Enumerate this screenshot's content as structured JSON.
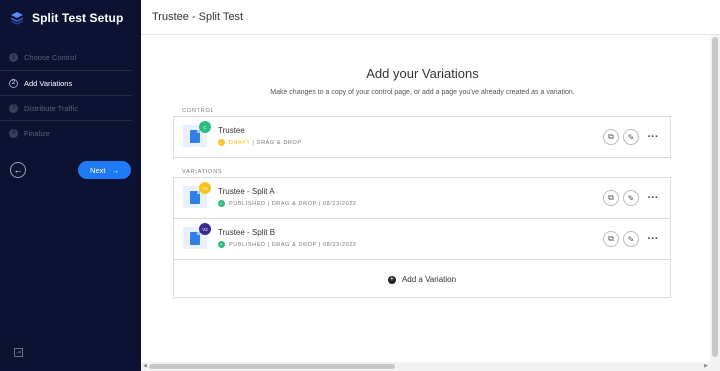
{
  "sidebar": {
    "title": "Split Test Setup",
    "steps": [
      {
        "num": "1",
        "label": "Choose Control"
      },
      {
        "num": "2",
        "label": "Add Variations"
      },
      {
        "num": "3",
        "label": "Distribute Traffic"
      },
      {
        "num": "4",
        "label": "Finalize"
      }
    ],
    "next_label": "Next"
  },
  "header": {
    "title": "Trustee - Split Test"
  },
  "main": {
    "title": "Add your Variations",
    "subtitle": "Make changes to a copy of your control page, or add a page you've already created as a variation.",
    "control_label": "CONTROL",
    "variations_label": "VARIATIONS",
    "control": {
      "badge": "C",
      "badge_color": "#2bbb7f",
      "name": "Trustee",
      "status": "DRAFT",
      "status_color": "#f5c518",
      "meta": "| DRAG & DROP"
    },
    "variations": [
      {
        "badge": "V1",
        "badge_color": "#f5c518",
        "name": "Trustee - Split A",
        "status": "PUBLISHED",
        "status_color": "#2bbb7f",
        "meta": "| DRAG & DROP | 08/23/2022"
      },
      {
        "badge": "V2",
        "badge_color": "#3b2a8f",
        "name": "Trustee - Split B",
        "status": "PUBLISHED",
        "status_color": "#2bbb7f",
        "meta": "| DRAG & DROP | 08/23/2022"
      }
    ],
    "add_variation_label": "Add a Variation"
  },
  "icons": {
    "copy": "copy-icon",
    "edit": "pencil-icon",
    "more": "more-icon"
  },
  "colors": {
    "sidebar_bg": "#0d1232",
    "accent": "#1e7af5"
  }
}
